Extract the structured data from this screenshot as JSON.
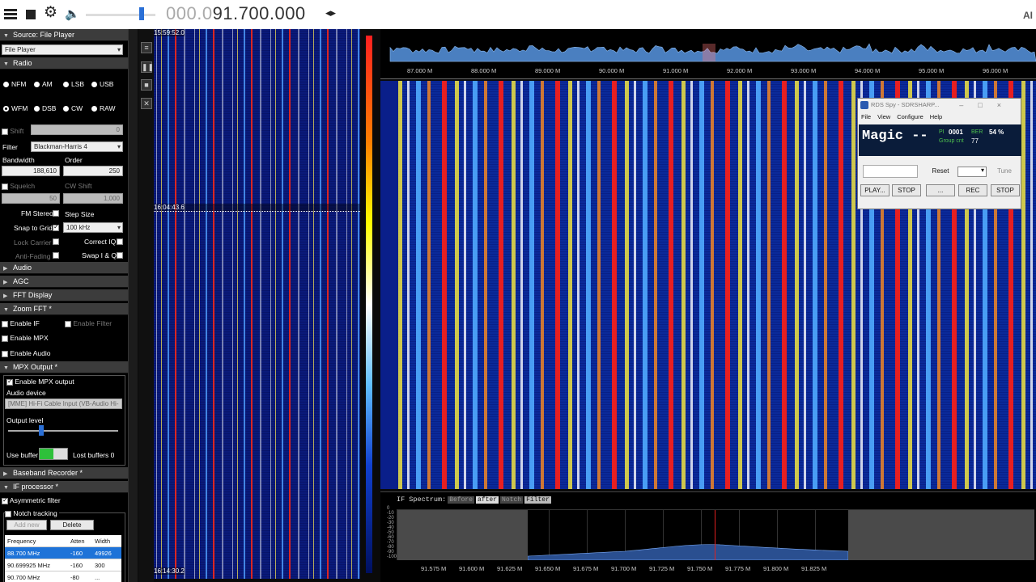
{
  "toolbar": {
    "frequency_dim": "000.0",
    "frequency_main": "91.700.000",
    "freq_step_arrows": "◂▸",
    "brand_glyph": "AI"
  },
  "left_panel": {
    "source_section": "Source: File Player",
    "source_select": "File Player",
    "radio_section": "Radio",
    "modes_row1": [
      "NFM",
      "AM",
      "LSB",
      "USB"
    ],
    "modes_row2": [
      "WFM",
      "DSB",
      "CW",
      "RAW"
    ],
    "shift_label": "Shift",
    "shift_value": "0",
    "filter_label": "Filter",
    "filter_value": "Blackman-Harris 4",
    "bandwidth_label": "Bandwidth",
    "bandwidth_value": "188,610",
    "order_label": "Order",
    "order_value": "250",
    "squelch_label": "Squelch",
    "squelch_value": "50",
    "cw_shift_label": "CW Shift",
    "cw_shift_value": "1,000",
    "fm_stereo_label": "FM Stereo",
    "step_size_label": "Step Size",
    "snap_grid_label": "Snap to Grid",
    "step_size_value": "100 kHz",
    "lock_carrier_label": "Lock Carrier",
    "correct_iq_label": "Correct IQ",
    "anti_fading_label": "Anti-Fading",
    "swap_iq_label": "Swap I & Q",
    "audio_section": "Audio",
    "agc_section": "AGC",
    "fft_display_section": "FFT Display",
    "zoom_fft_section": "Zoom FFT *",
    "enable_if_label": "Enable IF",
    "enable_filter_label": "Enable Filter",
    "enable_mpx_label": "Enable MPX",
    "enable_audio_label": "Enable Audio",
    "mpx_output_section": "MPX Output *",
    "enable_mpx_output_label": "Enable MPX output",
    "audio_device_label": "Audio device",
    "audio_device_value": "[MME] Hi-Fi Cable Input (VB-Audio Hi-",
    "output_level_label": "Output level",
    "output_level_fraction": 0.3,
    "use_buffer_label": "Use buffer",
    "lost_buffers_label": "Lost buffers 0",
    "baseband_recorder_section": "Baseband Recorder *",
    "if_processor_section": "IF processor *",
    "asym_filter_label": "Asymmetric filter",
    "notch_tracking_label": "Notch tracking",
    "add_new_label": "Add new",
    "delete_label": "Delete",
    "notch_headers": [
      "Frequency",
      "Atten",
      "Width"
    ],
    "notch_rows": [
      [
        "88.700 MHz",
        "-160",
        "49926"
      ],
      [
        "90.699925 MHz",
        "-160",
        "300"
      ],
      [
        "90.700 MHz",
        "-80",
        "..."
      ]
    ]
  },
  "waterfall_left": {
    "time_top": "15:59:52.0",
    "time_mid": "16:04:43.6",
    "time_bottom": "16:14:30.2"
  },
  "spectrum": {
    "ticks": [
      "87.000 M",
      "88.000 M",
      "89.000 M",
      "90.000 M",
      "91.000 M",
      "92.000 M",
      "93.000 M",
      "94.000 M",
      "95.000 M",
      "96.000 M"
    ]
  },
  "if_spectrum": {
    "title": "IF Spectrum:",
    "tabs": [
      "Before",
      "after",
      "Notch",
      "Filter"
    ],
    "db_labels": [
      "0",
      "-10",
      "-20",
      "-30",
      "-40",
      "-50",
      "-60",
      "-70",
      "-80",
      "-90",
      "-100"
    ],
    "ticks": [
      "91.575 M",
      "91.600 M",
      "91.625 M",
      "91.650 M",
      "91.675 M",
      "91.700 M",
      "91.725 M",
      "91.750 M",
      "91.775 M",
      "91.800 M",
      "91.825 M"
    ]
  },
  "rds_window": {
    "title": "RDS Spy - SDRSHARP...",
    "window_controls": "–□×",
    "menu": [
      "File",
      "View",
      "Configure",
      "Help"
    ],
    "ps_text": "Magic --",
    "pi_label": "PI",
    "pi_value": "0001",
    "ber_label": "BER",
    "ber_value": "54 %",
    "group_cnt_label": "Group cnt",
    "group_cnt_value": "77",
    "reset_label": "Reset",
    "tune_label": "Tune",
    "buttons": [
      "PLAY...",
      "STOP",
      "...",
      "REC",
      "STOP"
    ]
  }
}
